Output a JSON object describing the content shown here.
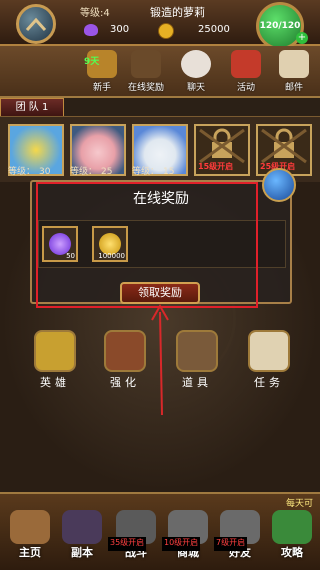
{
  "player": {
    "level_label": "等级:4",
    "name": "锻造的萝莉",
    "gems": "300",
    "gold": "25000",
    "energy": "120/120"
  },
  "activities": {
    "days_badge": "9天",
    "items": [
      {
        "label": "新手",
        "color": "#b8842a"
      },
      {
        "label": "在线奖励",
        "color": "#6a4a2a"
      },
      {
        "label": "聊天",
        "color": "#e8e0d8"
      },
      {
        "label": "活动",
        "color": "#c43a2a"
      },
      {
        "label": "邮件",
        "color": "#e0d0b0"
      }
    ]
  },
  "team": {
    "tab_label": "团 队 1",
    "heroes": [
      {
        "level_label": "等级：",
        "level": "30",
        "color": "#5aa6e0"
      },
      {
        "level_label": "等级：",
        "level": "25",
        "color": "#e8a0a8"
      },
      {
        "level_label": "等级：",
        "level": "15",
        "color": "#5a88d8"
      }
    ],
    "locked": [
      {
        "text": "15级开启"
      },
      {
        "text": "25级开启"
      }
    ]
  },
  "popup": {
    "title": "在线奖励",
    "rewards": [
      {
        "name": "宝石",
        "count": "50",
        "color": "#9a6ad8"
      },
      {
        "name": "金币",
        "count": "100000",
        "color": "#e8b22a"
      }
    ],
    "claim_label": "领取奖励"
  },
  "menu": [
    {
      "label": "英雄"
    },
    {
      "label": "强化"
    },
    {
      "label": "道具"
    },
    {
      "label": "任务"
    }
  ],
  "bottom": {
    "daily": "每天可",
    "nav": [
      {
        "label": "主页"
      },
      {
        "label": "副本"
      },
      {
        "label": "战斗",
        "lock": "35级开启"
      },
      {
        "label": "商城",
        "lock": "10级开启"
      },
      {
        "label": "好友",
        "lock": "7级开启"
      },
      {
        "label": "攻略"
      }
    ]
  },
  "colors": {
    "highlight_box": "#e0202a",
    "arrow": "#d8282a"
  }
}
